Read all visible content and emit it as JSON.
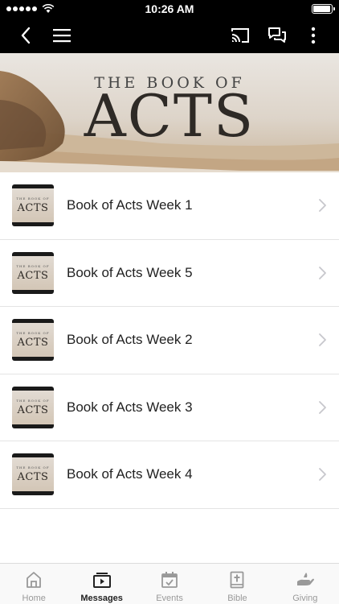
{
  "status_bar": {
    "time": "10:26 AM",
    "battery_level": 0.95
  },
  "nav": {
    "icons": [
      "back-icon",
      "menu-icon",
      "cast-icon",
      "chat-icon",
      "more-icon"
    ]
  },
  "banner": {
    "line1": "THE BOOK OF",
    "line2": "ACTS"
  },
  "thumbnail": {
    "line1": "THE BOOK OF",
    "line2": "ACTS"
  },
  "messages": [
    {
      "title": "Book of Acts Week 1"
    },
    {
      "title": "Book of Acts Week 5"
    },
    {
      "title": "Book of Acts Week 2"
    },
    {
      "title": "Book of Acts Week 3"
    },
    {
      "title": "Book of Acts Week 4"
    }
  ],
  "tabs": [
    {
      "label": "Home",
      "icon": "home-icon",
      "active": false
    },
    {
      "label": "Messages",
      "icon": "messages-icon",
      "active": true
    },
    {
      "label": "Events",
      "icon": "events-icon",
      "active": false
    },
    {
      "label": "Bible",
      "icon": "bible-icon",
      "active": false
    },
    {
      "label": "Giving",
      "icon": "giving-icon",
      "active": false
    }
  ],
  "colors": {
    "nav_bg": "#000000",
    "tab_active": "#222222",
    "tab_inactive": "#999999"
  }
}
